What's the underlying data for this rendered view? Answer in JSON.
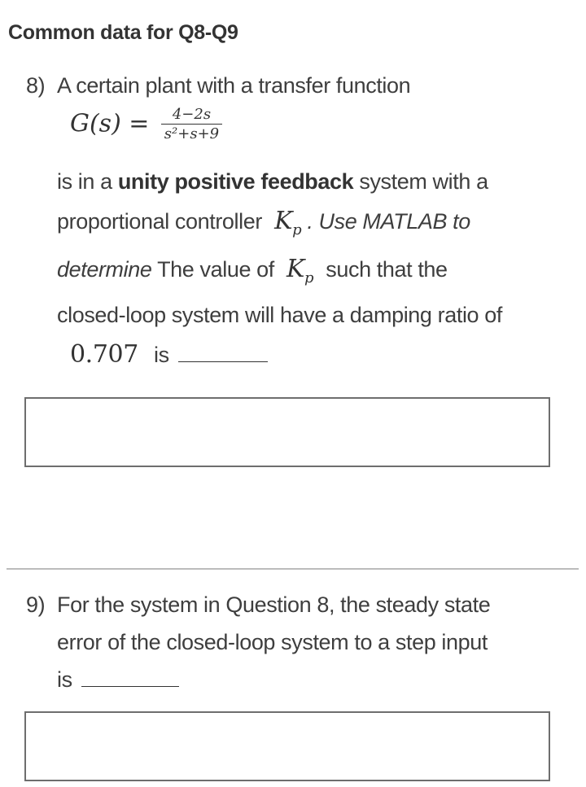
{
  "heading": "Common data for Q8-Q9",
  "q8": {
    "number": "8)",
    "line1": "A certain plant with a transfer function",
    "tf_lhs": "G(s) =",
    "tf_numerator": "4−2s",
    "tf_denominator": "s²+s+9",
    "line2_pre": "is in a",
    "line2_bold": "unity positive feedback",
    "line2_post": "system with a",
    "line3_pre": "proportional controller",
    "kp_symbol": "K",
    "kp_sub": "p",
    "line3_post": ". Use MATLAB to",
    "line4_italic": "determine",
    "line4_mid": "The value of",
    "line4_post": "such that the",
    "line5": "closed-loop system will have a damping ratio of",
    "line6_value": "0.707",
    "line6_post": "is",
    "answer_value": ""
  },
  "q9": {
    "number": "9)",
    "line1": "For the system in Question 8, the steady state",
    "line2": "error of the closed-loop system to a step input",
    "line3": "is",
    "answer_value": ""
  }
}
